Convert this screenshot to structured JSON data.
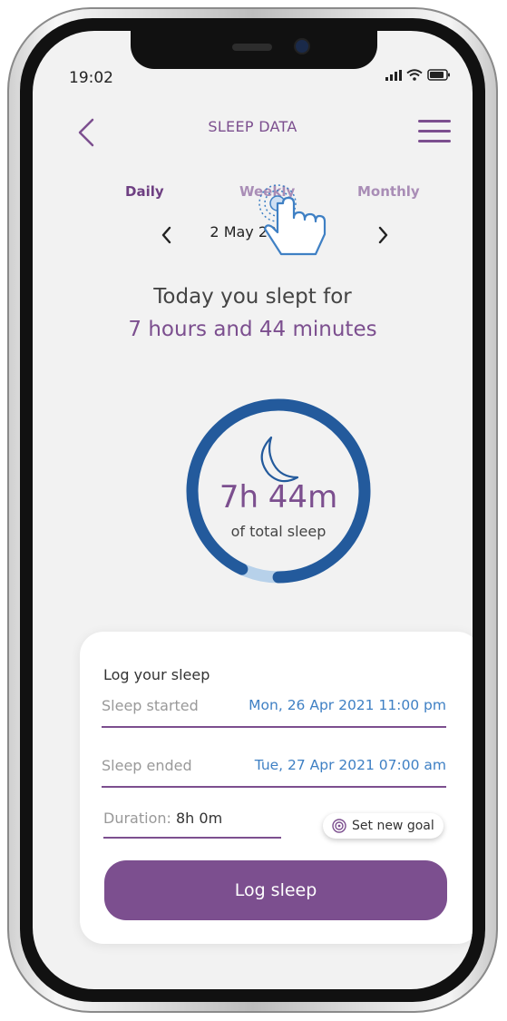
{
  "status_bar": {
    "time": "19:02"
  },
  "header": {
    "title": "SLEEP DATA"
  },
  "tabs": [
    {
      "label": "Daily",
      "active": true
    },
    {
      "label": "Weekly",
      "active": false
    },
    {
      "label": "Monthly",
      "active": false
    }
  ],
  "date_nav": {
    "date": "2 May 2021"
  },
  "summary": {
    "line1": "Today you slept for",
    "line2": "7 hours and 44 minutes"
  },
  "ring": {
    "value": "7h 44m",
    "label": "of total sleep",
    "progress": 0.93,
    "color": "#235a9c",
    "remaining_color": "#b7d1ea"
  },
  "log_card": {
    "title": "Log your sleep",
    "sleep_started_label": "Sleep started",
    "sleep_started_value": "Mon, 26 Apr 2021  11:00 pm",
    "sleep_ended_label": "Sleep ended",
    "sleep_ended_value": "Tue, 27 Apr 2021  07:00 am",
    "duration_label": "Duration:",
    "duration_value": "8h 0m",
    "goal_button": "Set new goal",
    "log_button": "Log sleep"
  },
  "colors": {
    "accent": "#7c4f8f",
    "link": "#3f80c4",
    "ring": "#235a9c"
  },
  "icons": [
    "back-chevron-icon",
    "menu-icon",
    "chevron-left-icon",
    "chevron-right-icon",
    "moon-icon",
    "target-icon",
    "pointer-hand-icon"
  ]
}
